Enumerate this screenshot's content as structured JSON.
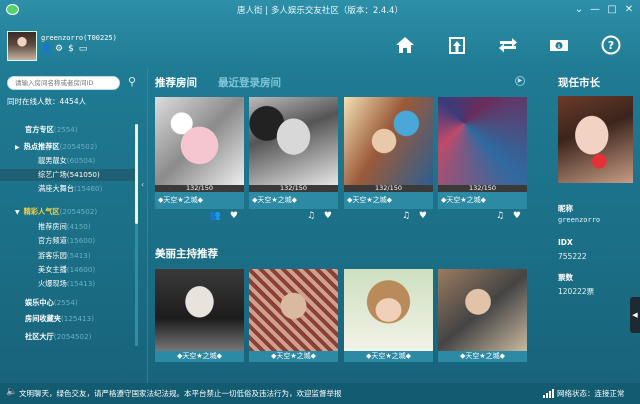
{
  "window": {
    "title": "唐人街 | 多人娱乐交友社区（版本：2.4.4）",
    "controls": {
      "menu": "⌄",
      "minimize": "—",
      "maximize": "□",
      "close": "✕"
    }
  },
  "profile": {
    "username": "greenzorro(T00225)",
    "icons": [
      "user-icon",
      "settings-icon",
      "coin-icon",
      "card-icon"
    ]
  },
  "top_nav": [
    "home-icon",
    "exit-room-icon",
    "swap-icon",
    "recharge-icon",
    "help-icon"
  ],
  "search": {
    "placeholder": "请输入房间名称或者房间ID"
  },
  "online": "同时在线人数：4454人",
  "sidebar": {
    "items": [
      {
        "label": "官方专区",
        "count": "(2554)",
        "indent": 0,
        "arrow": ""
      },
      {
        "label": "热点推荐区",
        "count": "(2054502)",
        "indent": 0,
        "arrow": "▶"
      },
      {
        "label": "靓男靓女",
        "count": "(60504)",
        "indent": 1,
        "arrow": ""
      },
      {
        "label": "综艺广场",
        "count": "(541050)",
        "indent": 1,
        "arrow": "",
        "highlight": true
      },
      {
        "label": "满座大舞台",
        "count": "(15460)",
        "indent": 1,
        "arrow": ""
      },
      {
        "label": "精彩人气区",
        "count": "(2054502)",
        "indent": 0,
        "arrow": "▼",
        "gold": true
      },
      {
        "label": "推荐房间",
        "count": "(4150)",
        "indent": 1,
        "arrow": ""
      },
      {
        "label": "官方频道",
        "count": "(15600)",
        "indent": 1,
        "arrow": ""
      },
      {
        "label": "游客乐园",
        "count": "(5413)",
        "indent": 1,
        "arrow": ""
      },
      {
        "label": "美女主播",
        "count": "(14600)",
        "indent": 1,
        "arrow": ""
      },
      {
        "label": "火爆现场",
        "count": "(15413)",
        "indent": 1,
        "arrow": ""
      },
      {
        "label": "娱乐中心",
        "count": "(2554)",
        "indent": 0,
        "arrow": ""
      },
      {
        "label": "房间收藏夹",
        "count": "(125413)",
        "indent": 0,
        "arrow": ""
      },
      {
        "label": "社区大厅",
        "count": "(2054502)",
        "indent": 0,
        "arrow": ""
      }
    ]
  },
  "tabs": {
    "recommended": "推荐房间",
    "recent": "最近登录房间"
  },
  "rooms": [
    {
      "capacity": "132/150",
      "name": "◆天空★之城◆",
      "icons": "👥 ♥"
    },
    {
      "capacity": "132/150",
      "name": "◆天空★之城◆",
      "icons": "♫ ♥"
    },
    {
      "capacity": "132/150",
      "name": "◆天空★之城◆",
      "icons": "♫ ♥"
    },
    {
      "capacity": "132/150",
      "name": "◆天空★之城◆",
      "icons": "♫ ♥"
    }
  ],
  "section2": {
    "title": "美丽主持推荐"
  },
  "hosts": [
    {
      "name": "◆天空★之城◆"
    },
    {
      "name": "◆天空★之城◆"
    },
    {
      "name": "◆天空★之城◆"
    },
    {
      "name": "◆天空★之城◆"
    }
  ],
  "mayor": {
    "title": "现任市长",
    "nickname_label": "昵称",
    "nickname": "greenzorro",
    "idx_label": "IDX",
    "idx": "755222",
    "tickets_label": "票数",
    "tickets": "120222票"
  },
  "status": {
    "notice": "文明聊天，绿色交友，请严格遵守国家法纪法规。本平台禁止一切低俗及违法行为，欢迎监督举报",
    "network": "网络状态：连接正常"
  }
}
